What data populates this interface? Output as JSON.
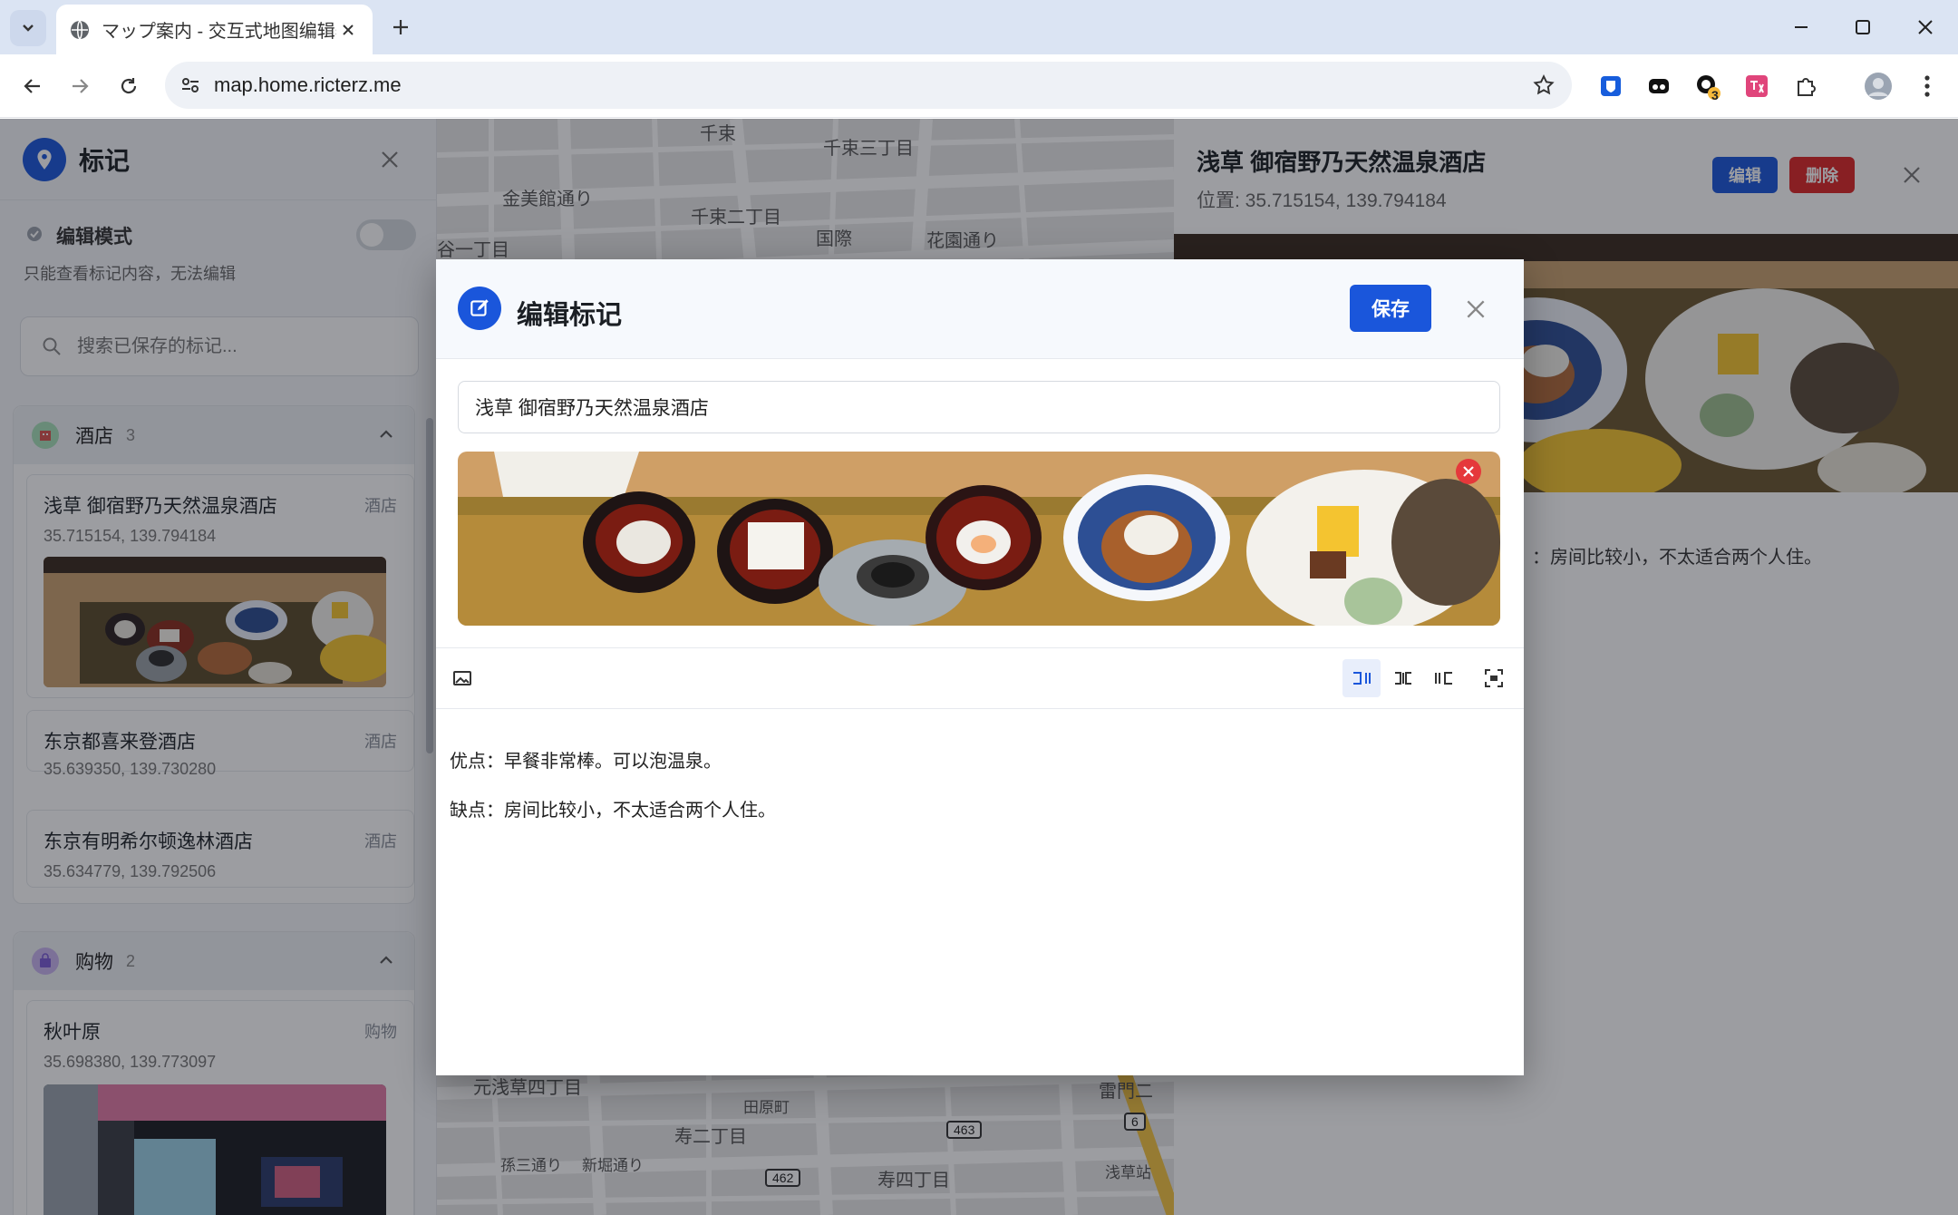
{
  "browser": {
    "tab_title": "マップ案内 - 交互式地图编辑器",
    "url": "map.home.ricterz.me",
    "extension_badge": "3"
  },
  "sidebar": {
    "title": "标记",
    "edit_mode_label": "编辑模式",
    "edit_mode_hint": "只能查看标记内容，无法编辑",
    "edit_mode_on": false,
    "search_placeholder": "搜索已保存的标记...",
    "categories": [
      {
        "name": "酒店",
        "count": "3",
        "places": [
          {
            "name": "浅草 御宿野乃天然温泉酒店",
            "tag": "酒店",
            "coords": "35.715154, 139.794184"
          },
          {
            "name": "东京都喜来登酒店",
            "tag": "酒店",
            "coords": "35.639350, 139.730280"
          },
          {
            "name": "东京有明希尔顿逸林酒店",
            "tag": "酒店",
            "coords": "35.634779, 139.792506"
          }
        ]
      },
      {
        "name": "购物",
        "count": "2",
        "places": [
          {
            "name": "秋叶原",
            "tag": "购物",
            "coords": "35.698380, 139.773097"
          }
        ]
      }
    ]
  },
  "map": {
    "labels": [
      "千束",
      "千束三丁目",
      "金美館通り",
      "千束二丁目",
      "国際",
      "花園通り",
      "谷一丁目",
      "元浅草四丁目",
      "田原町",
      "寿二丁目",
      "寿四丁目",
      "雷門二",
      "浅草站",
      "孫三通り",
      "新堀通り"
    ],
    "route_signs": [
      "463",
      "462",
      "6"
    ]
  },
  "detail": {
    "title": "浅草 御宿野乃天然温泉酒店",
    "position": "位置: 35.715154, 139.794184",
    "edit_label": "编辑",
    "delete_label": "删除",
    "note_fragment": "：房间比较小，不太适合两个人住。"
  },
  "modal": {
    "title": "编辑标记",
    "save_label": "保存",
    "name_value": "浅草 御宿野乃天然温泉酒店",
    "body_line1": "优点：早餐非常棒。可以泡温泉。",
    "body_line2": "缺点：房间比较小，不太适合两个人住。"
  },
  "colors": {
    "accent": "#1a56db",
    "danger": "#dc2626",
    "tab_strip": "#dbe4f3"
  }
}
